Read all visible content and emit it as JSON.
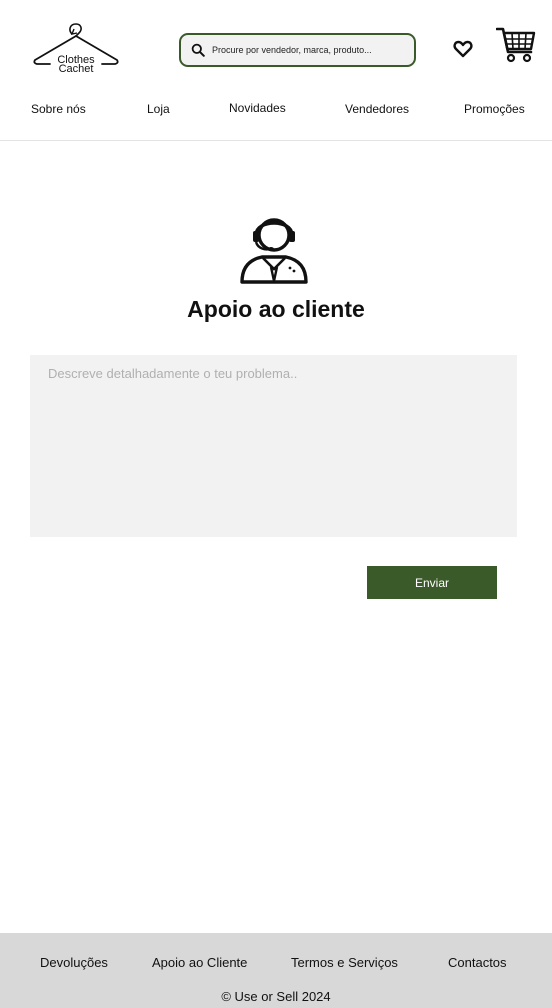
{
  "header": {
    "logo": {
      "line1": "Clothes",
      "line2": "Cachet"
    },
    "search": {
      "placeholder": "Procure por vendedor, marca, produto..."
    },
    "icons": {
      "search": "search-icon",
      "wishlist": "heart-icon",
      "cart": "cart-icon"
    }
  },
  "nav": {
    "items": [
      {
        "label": "Sobre nós"
      },
      {
        "label": "Loja"
      },
      {
        "label": "Novidades"
      },
      {
        "label": "Vendedores"
      },
      {
        "label": "Promoções"
      }
    ]
  },
  "main": {
    "icon": "customer-support-agent-icon",
    "title": "Apoio ao cliente",
    "problem_placeholder": "Descreve detalhadamente o teu problema..",
    "submit_label": "Enviar"
  },
  "footer": {
    "links": [
      {
        "label": "Devoluções"
      },
      {
        "label": "Apoio ao Cliente"
      },
      {
        "label": "Termos e Serviços"
      },
      {
        "label": "Contactos"
      }
    ],
    "copyright": "© Use or Sell 2024"
  },
  "colors": {
    "accent": "#3b5a2a",
    "input_background": "#f2f2f2",
    "footer_background": "#d8d8d8"
  }
}
